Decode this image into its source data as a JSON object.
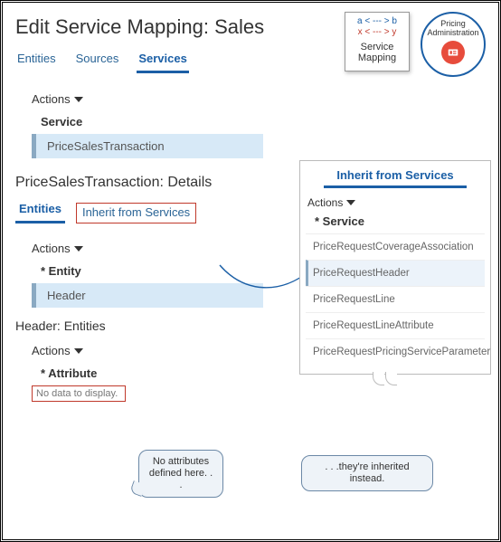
{
  "header": {
    "title": "Edit Service Mapping: Sales"
  },
  "topIcons": {
    "serviceMapping": {
      "line1": "a < --- > b",
      "line2": "x < --- > y",
      "label": "Service Mapping"
    },
    "pricingAdmin": {
      "label": "Pricing Administration"
    }
  },
  "mainTabs": [
    {
      "label": "Entities"
    },
    {
      "label": "Sources"
    },
    {
      "label": "Services",
      "active": true
    }
  ],
  "servicesSection": {
    "actionsLabel": "Actions",
    "columnHeader": "Service",
    "selectedRow": "PriceSalesTransaction"
  },
  "details": {
    "title": "PriceSalesTransaction: Details",
    "tabs": [
      {
        "label": "Entities",
        "active": true
      },
      {
        "label": "Inherit from Services",
        "highlighted": true
      }
    ],
    "actionsLabel": "Actions",
    "entityHeader": "Entity",
    "entityRow": "Header"
  },
  "headerEntities": {
    "title": "Header: Entities",
    "actionsLabel": "Actions",
    "attributeHeader": "Attribute",
    "noData": "No data to display."
  },
  "inheritPanel": {
    "title": "Inherit from Services",
    "actionsLabel": "Actions",
    "colHeader": "Service",
    "items": [
      "PriceRequestCoverageAssociation",
      "PriceRequestHeader",
      "PriceRequestLine",
      "PriceRequestLineAttribute",
      "PriceRequestPricingServiceParameter"
    ],
    "selectedIndex": 1
  },
  "callouts": {
    "noAttr": "No attributes defined here. . .",
    "inherited": ". . .they're inherited instead."
  }
}
